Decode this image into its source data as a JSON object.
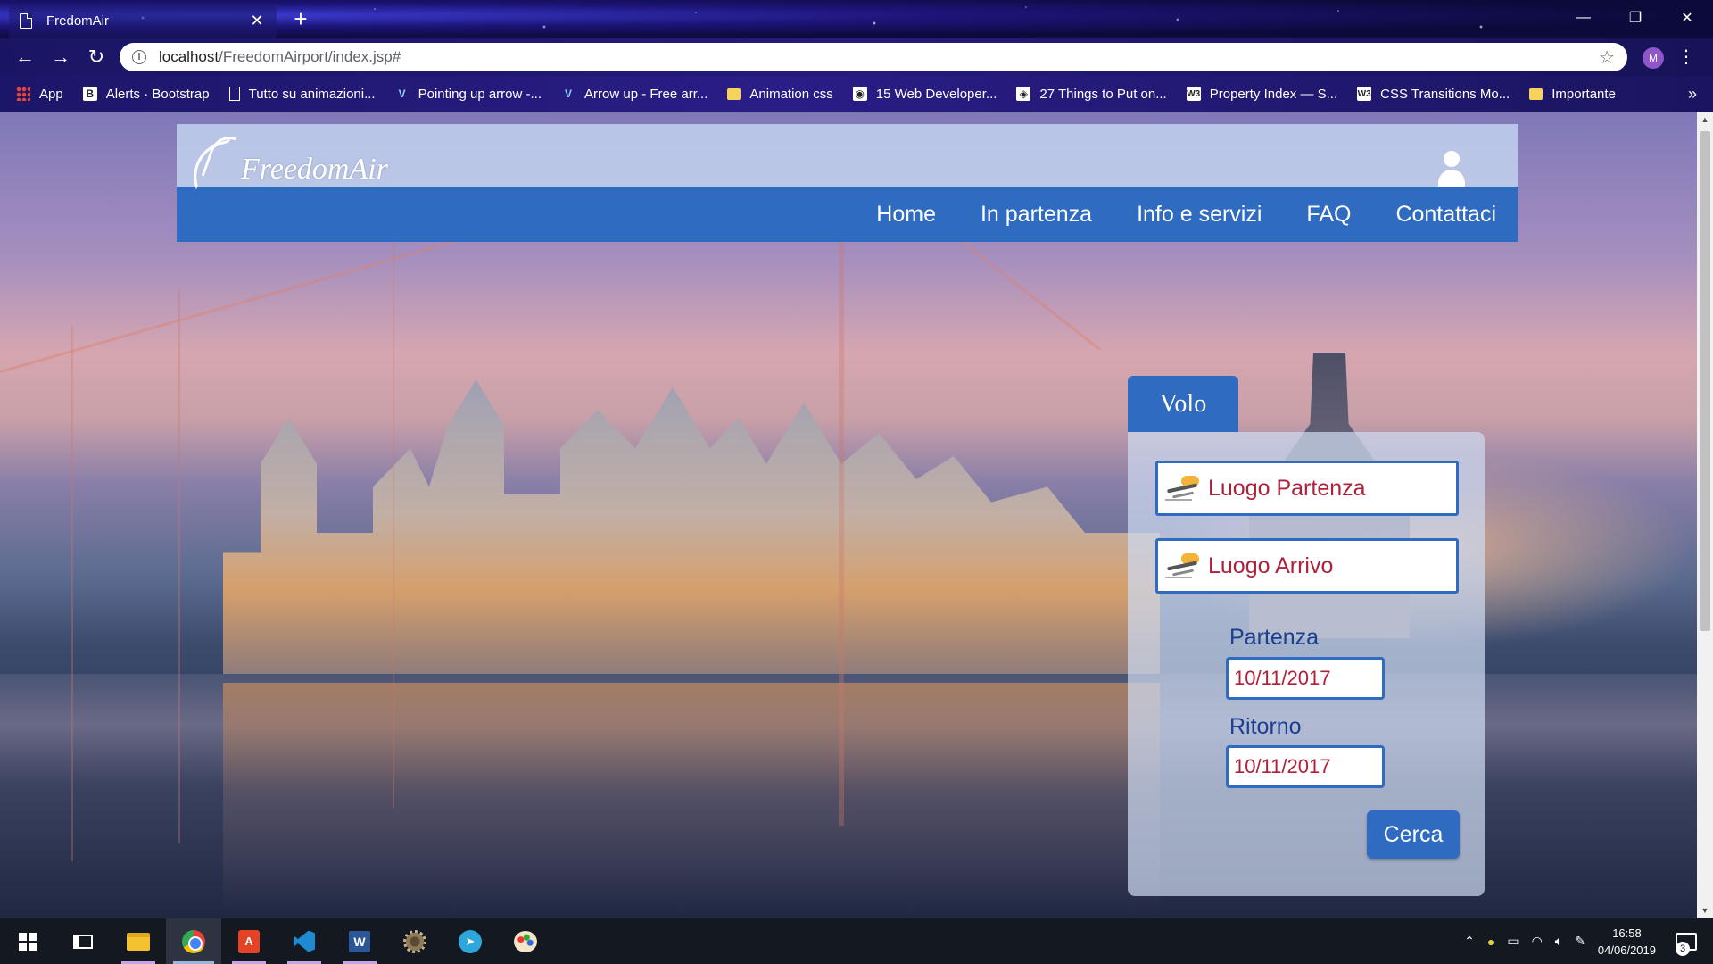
{
  "browser": {
    "tab_title": "FredomAir",
    "tab_close": "✕",
    "new_tab": "+",
    "url_host": "localhost",
    "url_path": "/FreedomAirport/index.jsp#",
    "profile_initial": "M",
    "window_controls": {
      "minimize": "—",
      "restore": "❐",
      "close": "✕"
    },
    "bookmarks": [
      {
        "label": "App",
        "icon": "apps-grid-icon"
      },
      {
        "label": "Alerts · Bootstrap",
        "icon": "bootstrap-icon",
        "glyph": "B"
      },
      {
        "label": "Tutto su animazioni...",
        "icon": "page-icon"
      },
      {
        "label": "Pointing up arrow -...",
        "icon": "vector-icon",
        "glyph": "V"
      },
      {
        "label": "Arrow up - Free arr...",
        "icon": "vector-icon",
        "glyph": "V"
      },
      {
        "label": "Animation css",
        "icon": "folder-icon"
      },
      {
        "label": "15 Web Developer...",
        "icon": "site-icon",
        "glyph": "◉"
      },
      {
        "label": "27 Things to Put on...",
        "icon": "site-icon",
        "glyph": "◈"
      },
      {
        "label": "Property Index — S...",
        "icon": "w3-icon",
        "glyph": "W3"
      },
      {
        "label": "CSS Transitions Mo...",
        "icon": "w3-icon",
        "glyph": "W3"
      },
      {
        "label": "Importante",
        "icon": "folder-icon"
      }
    ],
    "bookmarks_more": "»"
  },
  "site": {
    "logo_text": "FreedomAir",
    "nav": [
      "Home",
      "In partenza",
      "Info e servizi",
      "FAQ",
      "Contattaci"
    ]
  },
  "search": {
    "tab_label": "Volo",
    "departure_place": "Luogo Partenza",
    "arrival_place": "Luogo Arrivo",
    "departure_label": "Partenza",
    "departure_date": "10/11/2017",
    "return_label": "Ritorno",
    "return_date": "10/11/2017",
    "submit_label": "Cerca"
  },
  "taskbar": {
    "time": "16:58",
    "date": "04/06/2019",
    "notifications": "3"
  },
  "colors": {
    "accent": "#2f6bc1",
    "place_text": "#b0203a"
  }
}
